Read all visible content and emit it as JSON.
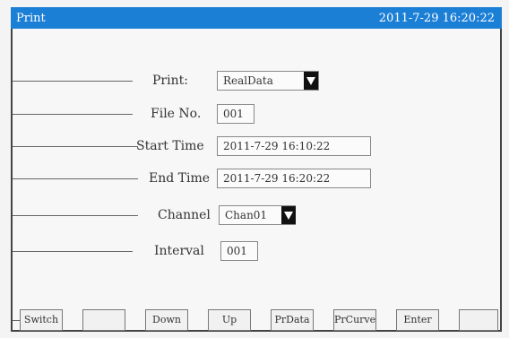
{
  "titlebar": {
    "title": "Print",
    "datetime": "2011-7-29  16:20:22"
  },
  "form": {
    "print": {
      "label": "Print:",
      "value": "RealData"
    },
    "file_no": {
      "label": "File No.",
      "value": "001"
    },
    "start_time": {
      "label": "Start Time",
      "value": "2011-7-29  16:10:22"
    },
    "end_time": {
      "label": "End Time",
      "value": "2011-7-29  16:20:22"
    },
    "channel": {
      "label": "Channel",
      "value": "Chan01"
    },
    "interval": {
      "label": "Interval",
      "value": "001"
    }
  },
  "fkeys": [
    "Switch",
    "",
    "Down",
    "Up",
    "PrData",
    "PrCurve",
    "Enter",
    ""
  ],
  "colors": {
    "titlebar": "#1c7fd6",
    "title_text": "#ffffff"
  }
}
